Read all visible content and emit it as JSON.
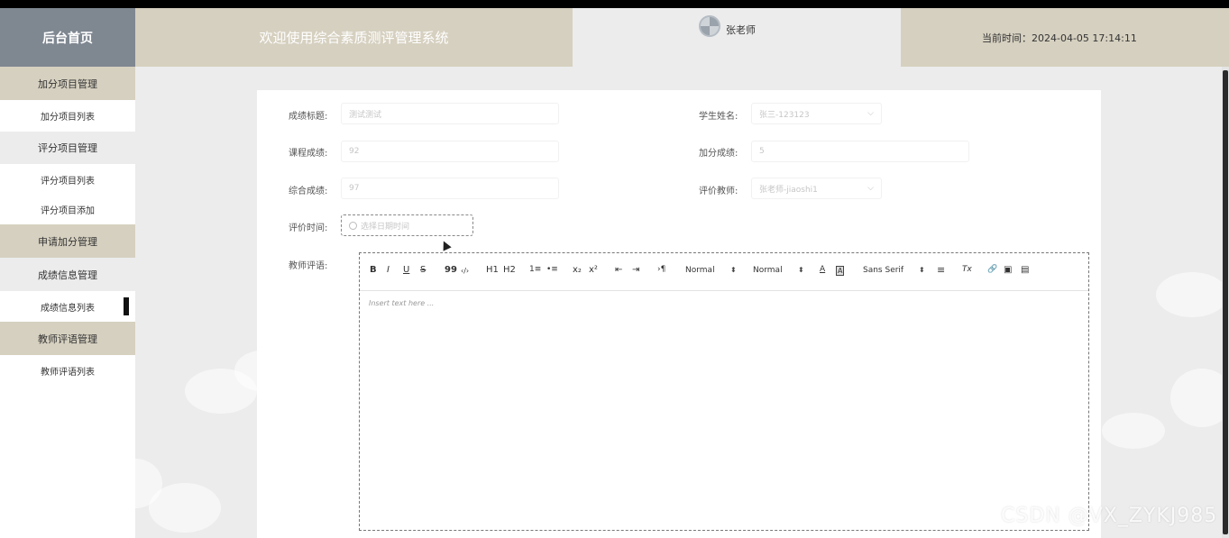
{
  "header": {
    "logo_text": "后台首页",
    "system_title": "欢迎使用综合素质测评管理系统",
    "user_name": "张老师",
    "current_time": "当前时间：2024-04-05 17:14:11"
  },
  "sidebar": {
    "items": [
      {
        "label": "加分项目管理",
        "type": "group"
      },
      {
        "label": "加分项目列表",
        "type": "sub"
      },
      {
        "label": "评分项目管理",
        "type": "group"
      },
      {
        "label": "评分项目列表",
        "type": "sub"
      },
      {
        "label": "评分项目添加",
        "type": "sub"
      },
      {
        "label": "申请加分管理",
        "type": "group"
      },
      {
        "label": "成绩信息管理",
        "type": "group"
      },
      {
        "label": "成绩信息列表",
        "type": "sub"
      },
      {
        "label": "教师评语管理",
        "type": "group"
      },
      {
        "label": "教师评语列表",
        "type": "sub"
      }
    ]
  },
  "form": {
    "title_label": "成绩标题:",
    "title_value": "测试测试",
    "student_label": "学生姓名:",
    "student_value": "张三-123123",
    "course_label": "课程成绩:",
    "course_value": "92",
    "bonus_label": "加分成绩:",
    "bonus_value": "5",
    "total_label": "综合成绩:",
    "total_value": "97",
    "teacher_label": "评价教师:",
    "teacher_value": "张老师-jiaoshi1",
    "time_label": "评价时间:",
    "time_placeholder": "选择日期时间",
    "comment_label": "教师评语:"
  },
  "editor": {
    "toolbar": {
      "bold": "B",
      "italic": "I",
      "underline": "U",
      "strike": "S",
      "blockquote": "99",
      "code": "‹/›",
      "h1": "H1",
      "h2": "H2",
      "ordered_list": "1≡",
      "bullet_list": "•≡",
      "subscript": "x₂",
      "superscript": "x²",
      "outdent": "⇤",
      "indent": "⇥",
      "direction": "›¶",
      "size_select": "Normal",
      "header_select": "Normal",
      "color": "A",
      "background": "A",
      "font_select": "Sans Serif",
      "align": "≡",
      "clean": "Tx",
      "link": "🔗",
      "image": "▣",
      "video": "▤"
    },
    "placeholder": "Insert text here ..."
  },
  "watermark": "CSDN @VX_ZYKJ985"
}
